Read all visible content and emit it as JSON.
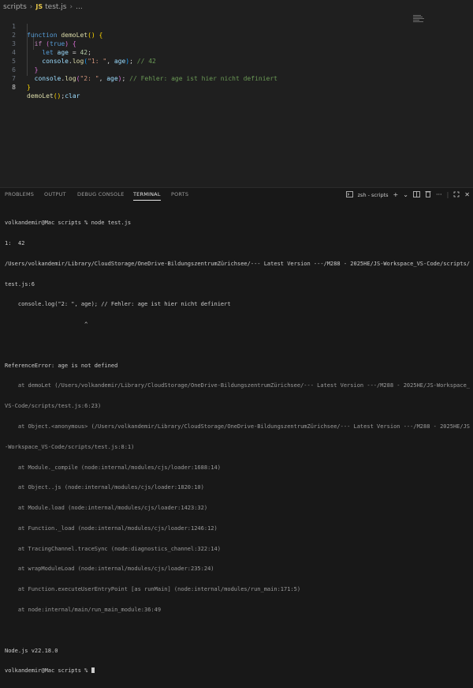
{
  "breadcrumb": {
    "folder": "scripts",
    "file_badge": "JS",
    "file": "test.js",
    "symbol": "..."
  },
  "editor": {
    "lines": [
      {
        "n": "1"
      },
      {
        "n": "2"
      },
      {
        "n": "3"
      },
      {
        "n": "4"
      },
      {
        "n": "5"
      },
      {
        "n": "6"
      },
      {
        "n": "7"
      },
      {
        "n": "8"
      }
    ],
    "code": {
      "l1_kw": "function",
      "l1_fn": "demoLet",
      "l1_paren": "()",
      "l1_brace": "{",
      "l2_kw": "if",
      "l2_cond": "true",
      "l2_brace": "{",
      "l3_kw": "let",
      "l3_var": "age",
      "l3_eq": " = ",
      "l3_num": "42",
      "l4_obj": "console",
      "l4_fn": "log",
      "l4_str": "\"1: \"",
      "l4_var": "age",
      "l4_cmt": "// 42",
      "l5_brace": "}",
      "l6_obj": "console",
      "l6_fn": "log",
      "l6_str": "\"2: \"",
      "l6_var": "age",
      "l6_cmt": "// Fehler: age ist hier nicht definiert",
      "l7_brace": "}",
      "l8_fn": "demoLet",
      "l8_rest": "clar"
    }
  },
  "panel": {
    "tabs": [
      "PROBLEMS",
      "OUTPUT",
      "DEBUG CONSOLE",
      "TERMINAL",
      "PORTS"
    ],
    "active_tab": "TERMINAL",
    "terminal_name": "zsh - scripts",
    "add_glyph": "+",
    "icons": [
      "terminal-icon",
      "add-icon",
      "chevron-down-icon",
      "split-icon",
      "trash-icon",
      "more-icon",
      "maximize-icon",
      "close-icon"
    ]
  },
  "terminal": {
    "lines": [
      "volkandemir@Mac scripts % node test.js",
      "1:  42",
      "/Users/volkandemir/Library/CloudStorage/OneDrive-BildungszentrumZürichsee/--- Latest Version ---/M288 - 2025HE/JS-Workspace_VS-Code/scripts/",
      "test.js:6",
      "    console.log(\"2: \", age); // Fehler: age ist hier nicht definiert",
      "                        ^",
      "",
      "ReferenceError: age is not defined",
      "    at demoLet (/Users/volkandemir/Library/CloudStorage/OneDrive-BildungszentrumZürichsee/--- Latest Version ---/M288 - 2025HE/JS-Workspace_",
      "VS-Code/scripts/test.js:6:23)",
      "    at Object.<anonymous> (/Users/volkandemir/Library/CloudStorage/OneDrive-BildungszentrumZürichsee/--- Latest Version ---/M288 - 2025HE/JS",
      "-Workspace_VS-Code/scripts/test.js:8:1)",
      "    at Module._compile (node:internal/modules/cjs/loader:1688:14)",
      "    at Object..js (node:internal/modules/cjs/loader:1820:10)",
      "    at Module.load (node:internal/modules/cjs/loader:1423:32)",
      "    at Function._load (node:internal/modules/cjs/loader:1246:12)",
      "    at TracingChannel.traceSync (node:diagnostics_channel:322:14)",
      "    at wrapModuleLoad (node:internal/modules/cjs/loader:235:24)",
      "    at Function.executeUserEntryPoint [as runMain] (node:internal/modules/run_main:171:5)",
      "    at node:internal/main/run_main_module:36:49",
      "",
      "Node.js v22.18.0",
      "volkandemir@Mac scripts % "
    ]
  }
}
